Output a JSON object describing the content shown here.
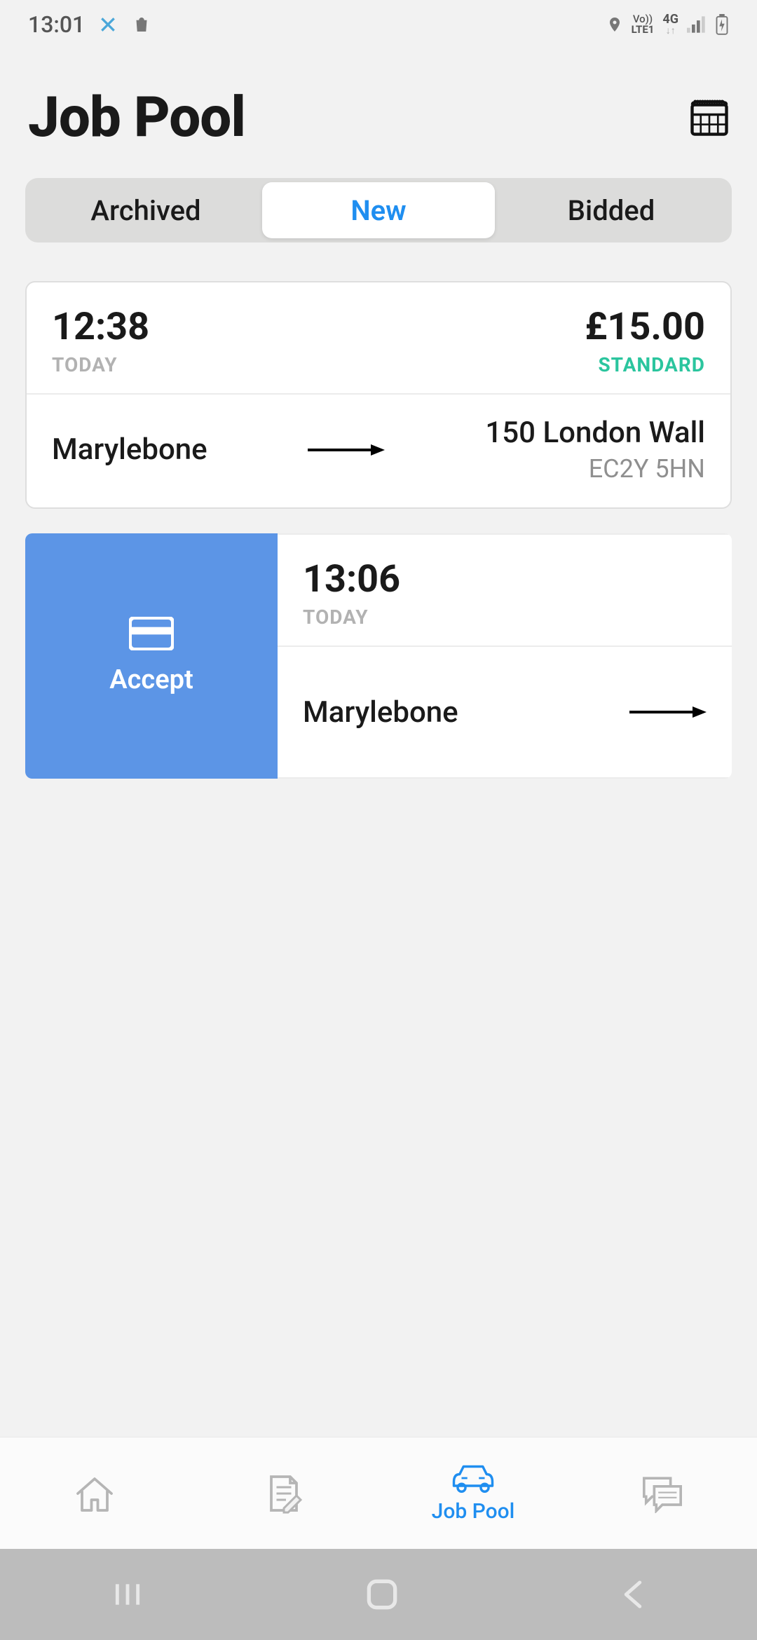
{
  "status": {
    "time": "13:01",
    "volte": "Vo))",
    "lte": "LTE1",
    "net": "4G"
  },
  "header": {
    "title": "Job Pool"
  },
  "segments": {
    "archived": "Archived",
    "new": "New",
    "bidded": "Bidded"
  },
  "jobs": [
    {
      "time": "12:38",
      "day": "TODAY",
      "price": "£15.00",
      "tag": "STANDARD",
      "from": "Marylebone",
      "to_addr": "150 London Wall",
      "to_pc": "EC2Y 5HN"
    },
    {
      "time": "13:06",
      "day": "TODAY",
      "from": "Marylebone",
      "swipe_action": "Accept"
    }
  ],
  "tabs": {
    "jobpool_label": "Job Pool"
  }
}
